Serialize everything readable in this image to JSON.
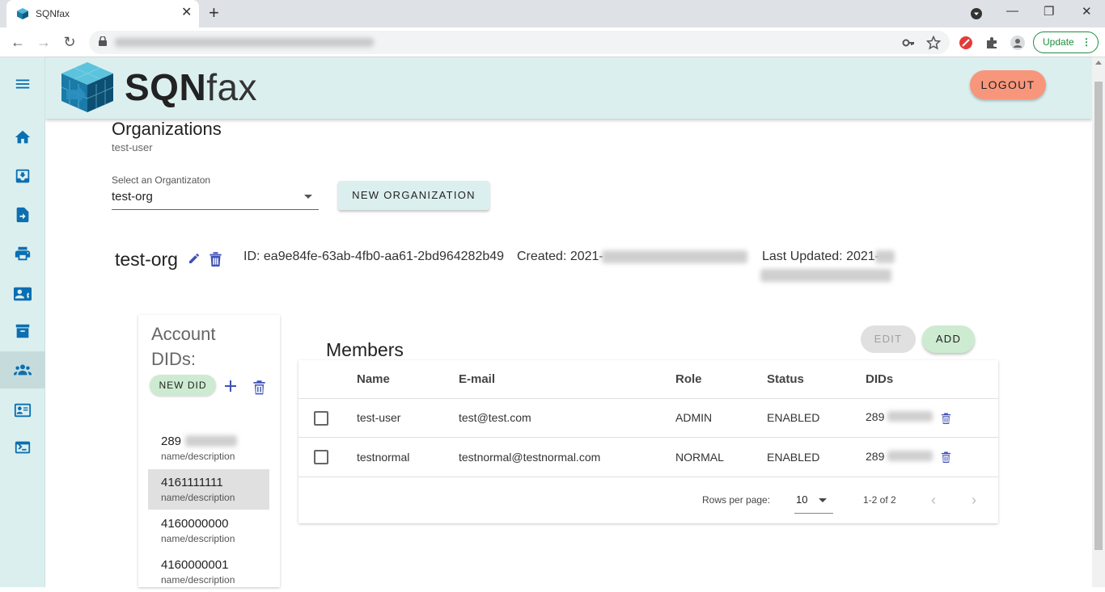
{
  "browser": {
    "tab_title": "SQNfax",
    "update_label": "Update"
  },
  "header": {
    "logo_bold": "SQN",
    "logo_light": "fax",
    "logout_label": "LOGOUT"
  },
  "page": {
    "title": "Organizations",
    "subtitle": "test-user",
    "select_label": "Select an Organtizaton",
    "select_value": "test-org",
    "new_org_label": "NEW ORGANIZATION"
  },
  "org": {
    "name": "test-org",
    "id_text": "ID: ea9e84fe-63ab-4fb0-aa61-2bd964282b49",
    "created_text": "Created: 2021-",
    "updated_text": "Last Updated: 2021-"
  },
  "dids": {
    "title": "Account DIDs:",
    "new_did_label": "NEW DID",
    "items": [
      {
        "number": "289",
        "desc": "name/description",
        "selected": false
      },
      {
        "number": "4161111111",
        "desc": "name/description",
        "selected": true
      },
      {
        "number": "4160000000",
        "desc": "name/description",
        "selected": false
      },
      {
        "number": "4160000001",
        "desc": "name/description",
        "selected": false
      }
    ]
  },
  "members": {
    "title": "Members",
    "edit_label": "EDIT",
    "add_label": "ADD",
    "columns": [
      "Name",
      "E-mail",
      "Role",
      "Status",
      "DIDs"
    ],
    "rows": [
      {
        "name": "test-user",
        "email": "test@test.com",
        "role": "ADMIN",
        "status": "ENABLED",
        "did": "289"
      },
      {
        "name": "testnormal",
        "email": "testnormal@testnormal.com",
        "role": "NORMAL",
        "status": "ENABLED",
        "did": "289"
      }
    ],
    "rows_per_page_label": "Rows per page:",
    "rows_per_page": "10",
    "range": "1-2 of 2"
  },
  "colors": {
    "header_bg": "#dcefef",
    "logout_bg": "#f8967b",
    "accent_green": "#cdebd0",
    "icon_blue": "#0b6fb1"
  },
  "rail_icons": [
    "menu-icon",
    "home-icon",
    "inbox-icon",
    "send-fax-icon",
    "printer-icon",
    "contacts-icon",
    "archive-icon",
    "organizations-icon",
    "user-card-icon",
    "terminal-icon"
  ]
}
